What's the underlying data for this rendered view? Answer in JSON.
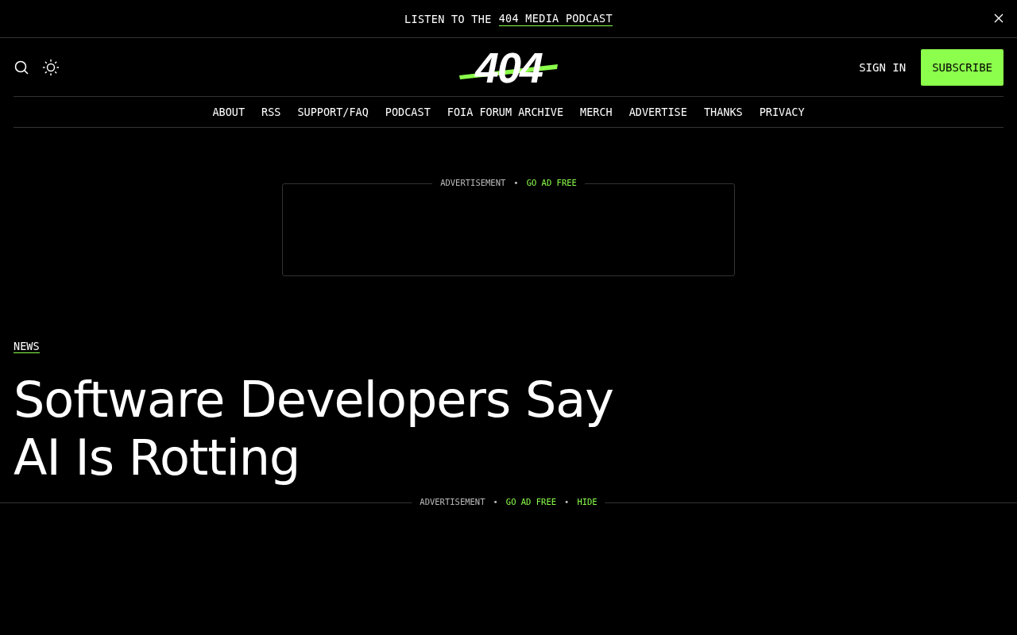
{
  "announcement": {
    "prefix": "LISTEN TO THE",
    "link": "404 MEDIA PODCAST"
  },
  "header": {
    "logo": "404",
    "sign_in": "SIGN IN",
    "subscribe": "SUBSCRIBE"
  },
  "nav": [
    "ABOUT",
    "RSS",
    "SUPPORT/FAQ",
    "PODCAST",
    "FOIA FORUM ARCHIVE",
    "MERCH",
    "ADVERTISE",
    "THANKS",
    "PRIVACY"
  ],
  "ad_top": {
    "label": "ADVERTISEMENT",
    "separator": "•",
    "links": [
      "GO AD FREE"
    ]
  },
  "article": {
    "category": "NEWS",
    "title": "Software Developers Say AI Is Rotting"
  },
  "ad_bottom": {
    "label": "ADVERTISEMENT",
    "separator": "•",
    "links": [
      "GO AD FREE",
      "HIDE"
    ]
  }
}
